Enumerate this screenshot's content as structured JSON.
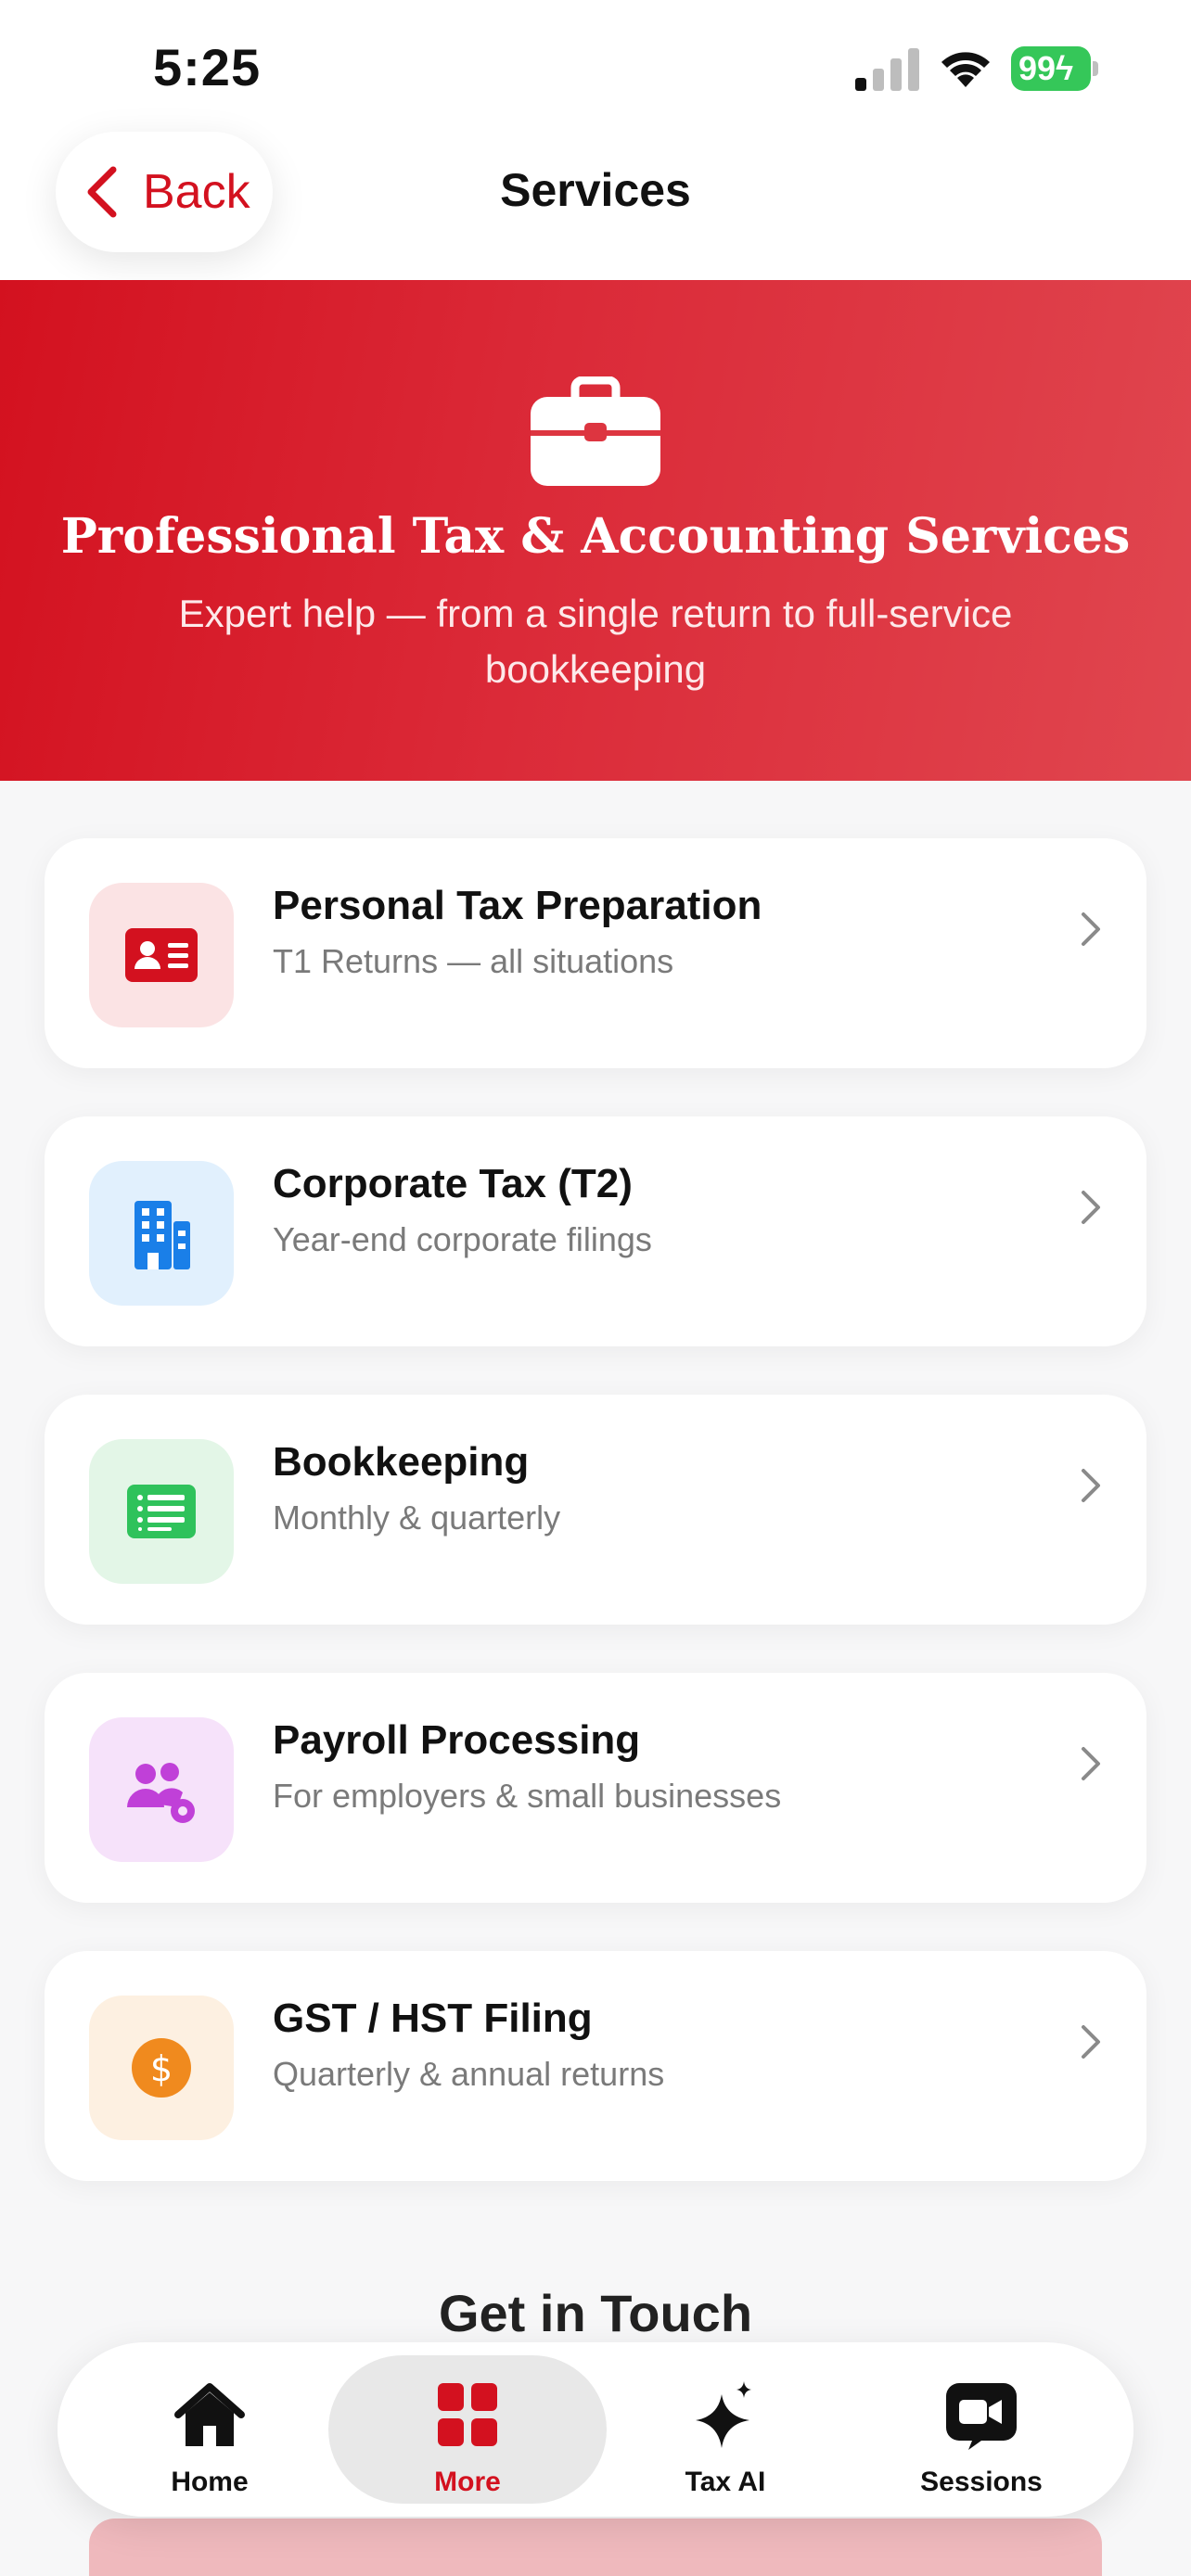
{
  "status_bar": {
    "time": "5:25",
    "battery": "99"
  },
  "header": {
    "back_label": "Back",
    "title": "Services"
  },
  "hero": {
    "title": "Professional Tax & Accounting Services",
    "subtitle": "Expert help — from a single return to full-service bookkeeping"
  },
  "services": [
    {
      "title": "Personal Tax Preparation",
      "subtitle": "T1 Returns — all situations",
      "icon": "id-card-icon",
      "color": "#d3111f",
      "bg": "#fbe3e4"
    },
    {
      "title": "Corporate Tax (T2)",
      "subtitle": "Year-end corporate filings",
      "icon": "building-icon",
      "color": "#1a7fe8",
      "bg": "#e1f0fd"
    },
    {
      "title": "Bookkeeping",
      "subtitle": "Monthly & quarterly",
      "icon": "ledger-icon",
      "color": "#2fc25b",
      "bg": "#e3f6e7"
    },
    {
      "title": "Payroll Processing",
      "subtitle": "For employers & small businesses",
      "icon": "people-gear-icon",
      "color": "#c040d8",
      "bg": "#f6e2fa"
    },
    {
      "title": "GST / HST Filing",
      "subtitle": "Quarterly & annual returns",
      "icon": "dollar-coin-icon",
      "color": "#f08a1e",
      "bg": "#fdf0e1"
    }
  ],
  "touch": {
    "title": "Get in Touch"
  },
  "tabs": [
    {
      "label": "Home",
      "icon": "home-icon",
      "active": false
    },
    {
      "label": "More",
      "icon": "grid-icon",
      "active": true
    },
    {
      "label": "Tax AI",
      "icon": "sparkle-icon",
      "active": false
    },
    {
      "label": "Sessions",
      "icon": "video-icon",
      "active": false
    }
  ],
  "colors": {
    "accent": "#d3111f",
    "background": "#f7f7f8"
  }
}
